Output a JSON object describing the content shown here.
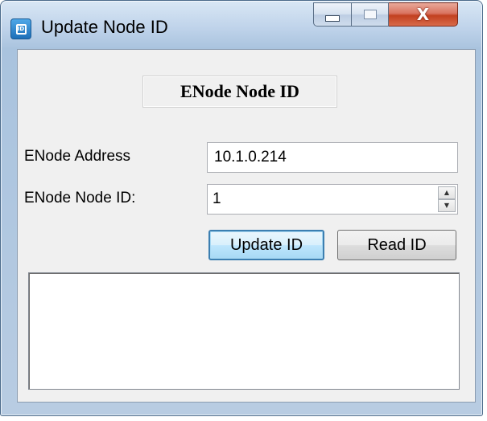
{
  "window": {
    "title": "Update Node ID",
    "icon": "chip-icon",
    "caption_buttons": {
      "minimize": "minimize-icon",
      "maximize": "maximize-icon",
      "close": "close-icon",
      "close_glyph": "X"
    }
  },
  "form": {
    "heading": "ENode Node ID",
    "address_label": "ENode Address",
    "address_value": "10.1.0.214",
    "node_id_label": "ENode Node ID:",
    "node_id_value": "1",
    "update_button": "Update ID",
    "read_button": "Read ID",
    "output_text": ""
  },
  "colors": {
    "client_background": "#f0f0f0",
    "focused_button_border": "#3c7fb1",
    "close_button": "#c2401f"
  }
}
